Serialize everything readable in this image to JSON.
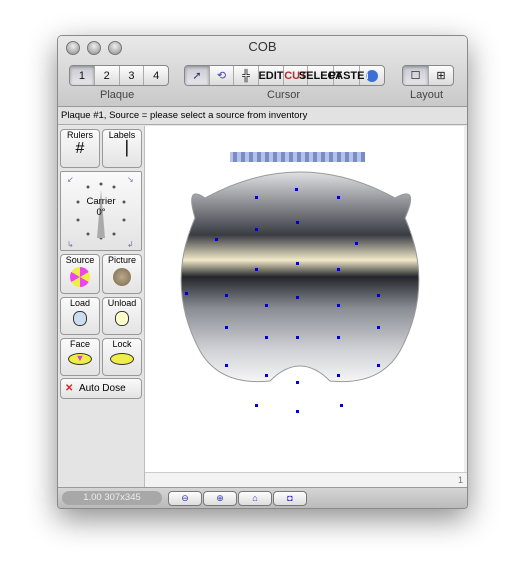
{
  "window": {
    "title": "COB"
  },
  "toolbar": {
    "plaque": {
      "label": "Plaque",
      "buttons": [
        "1",
        "2",
        "3",
        "4"
      ],
      "selected": "1"
    },
    "cursor": {
      "label": "Cursor",
      "tools": [
        {
          "icon": "select-arrow-icon",
          "text": ""
        },
        {
          "icon": "rotate-icon",
          "text": ""
        },
        {
          "icon": "move-icon",
          "text": ""
        },
        {
          "icon": "edit-icon",
          "text": "EDIT"
        },
        {
          "icon": "cut-icon",
          "text": "CUT"
        },
        {
          "icon": "select-icon",
          "text": "SELECT"
        },
        {
          "icon": "paste-icon",
          "text": "PASTE"
        },
        {
          "icon": "info-icon",
          "text": "i"
        }
      ]
    },
    "layout": {
      "label": "Layout",
      "options": [
        "single",
        "quad"
      ]
    }
  },
  "status": "Plaque #1, Source = please select a source from inventory",
  "sidebar": {
    "rulers": "Rulers",
    "labels": "Labels",
    "carrier": {
      "label": "Carrier",
      "angle": "0°"
    },
    "source": "Source",
    "picture": "Picture",
    "load": "Load",
    "unload": "Unload",
    "face": "Face",
    "lock": "Lock",
    "auto_dose": "Auto Dose"
  },
  "ruler_value": "1",
  "bottom": {
    "zoom": "1.00 307x345",
    "buttons": [
      "zoom-out",
      "zoom-in",
      "home",
      "fit"
    ]
  },
  "colors": {
    "dots": "#0000cc",
    "accent": "#3355cc"
  }
}
